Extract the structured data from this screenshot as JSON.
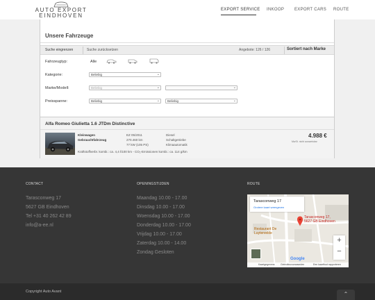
{
  "header": {
    "logo_line1": "AUTO EXPORT",
    "logo_line2": "EINDHOVEN",
    "nav": [
      "EXPORT SERVICE",
      "INKOOP",
      "EXPORT CARS",
      "ROUTE"
    ]
  },
  "listing": {
    "title": "Unsere Fahrzeuge",
    "search_label": "Suche eingrenzen",
    "reset_label": "Suche zurücksetzen",
    "count_text": "Angebote: 126 / 126",
    "sort_label": "Sortiert nach Marke",
    "filters": {
      "type_label": "Fahrzeugtyp:",
      "type_all": "Alle",
      "category_label": "Kategorie:",
      "category_value": "Beliebig",
      "make_label": "Marke/Modell:",
      "make_value": "Beliebig",
      "price_label": "Preisspanne:",
      "price_from": "Beliebig",
      "price_to": "Beliebig"
    },
    "result": {
      "title": "Alfa Romeo Giulietta 1.6 JTDm Distinctive",
      "class1": "Kleinwagen",
      "class2": "Gebrauchtfahrzeug",
      "reg": "EZ 05/2011",
      "km": "270.460 km",
      "power": "77 kW (105 PS)",
      "fuel": "Diesel",
      "gear": "Schaltgetriebe",
      "ac": "Klimaautomatik",
      "consumption": "Kraftstoffverbr. kombi.: ca. 4,4 l/100 km - CO₂-Emissionen kombi.: ca. 114 g/km",
      "price": "4.988 €",
      "vat": "MwSt. nicht ausweisbar"
    }
  },
  "footer": {
    "contact_head": "CONTACT",
    "contact": [
      "Tarasconweg 17",
      "5627 GB Eindhoven",
      "Tel +31 40 262 42 89",
      "info@a-ee.nl"
    ],
    "hours_head": "OPENINGSTIJDEN",
    "hours": [
      "Maandag 10.00 - 17.00",
      "Dinsdag 10.00 - 17.00",
      "Woensdag 10.00 - 17.00",
      "Donderdag 10.00 - 17.00",
      "Vrijdag 10.00 - 17.00",
      "Zaterdag 10.00 - 14.00",
      "Zondag Gesloten"
    ],
    "route_head": "ROUTE",
    "map": {
      "card_title": "Tarasconweg 17",
      "card_link": "Grotere kaart weergeven",
      "pin_line1": "Tarasconweg 17,",
      "pin_line2": "5627 GB Eindhoven",
      "place": "Restaurant De Luytervelde",
      "google": "Google",
      "attr": [
        "Kaartgegevens",
        "Gebruiksvoorwaarden",
        "Een kaartfout rapporteren"
      ]
    },
    "copyright": "Copyright Auto Avant"
  }
}
